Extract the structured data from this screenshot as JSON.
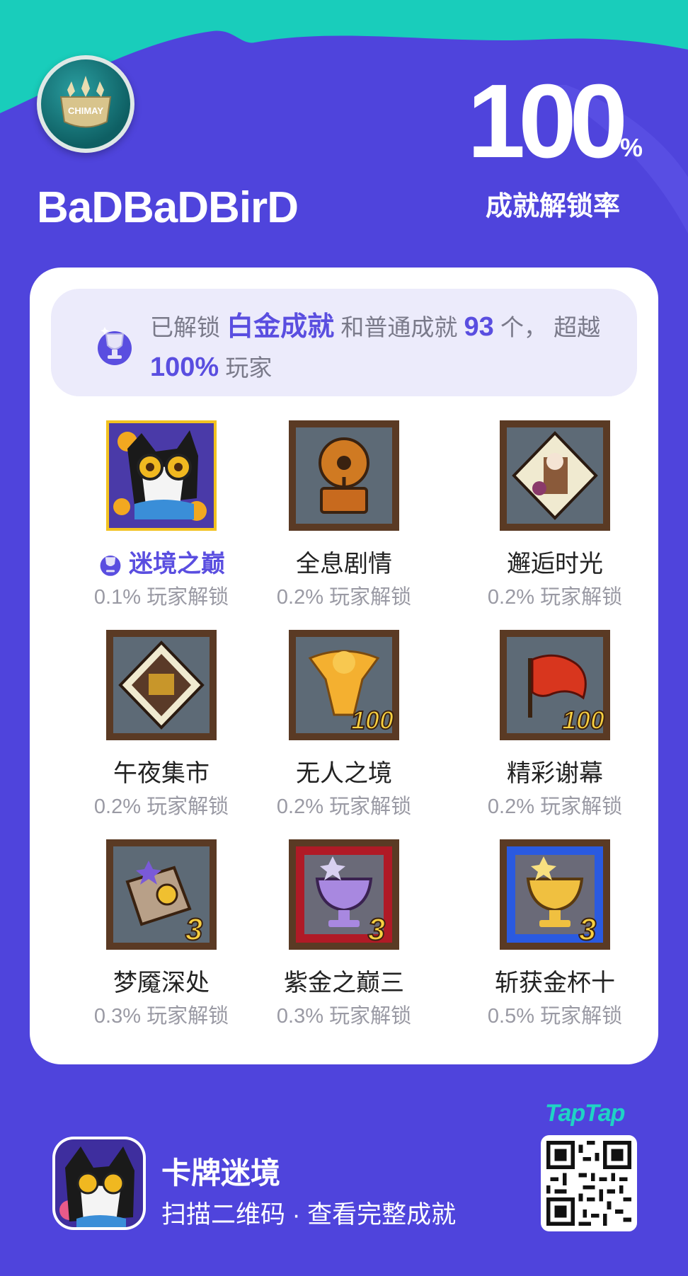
{
  "profile": {
    "username": "BaDBaDBirD",
    "avatar_text": "CHIMAY",
    "avatar_icon": "chimay-crest-icon"
  },
  "rate": {
    "value": "100",
    "percent_sign": "%",
    "label": "成就解锁率"
  },
  "summary": {
    "part1": "已解锁 ",
    "platinum": "白金成就",
    "part2": " 和普通成就 ",
    "count": "93",
    "part3": " 个， 超越 ",
    "percent": "100%",
    "part4": " 玩家"
  },
  "achievements": [
    {
      "name": "迷境之巅",
      "rate": "0.1% 玩家解锁",
      "platinum": true,
      "icon": "cat-portrait-icon"
    },
    {
      "name": "全息剧情",
      "rate": "0.2% 玩家解锁",
      "platinum": false,
      "icon": "gramophone-icon"
    },
    {
      "name": "邂逅时光",
      "rate": "0.2% 玩家解锁",
      "platinum": false,
      "icon": "puzzle-piece-icon"
    },
    {
      "name": "午夜集市",
      "rate": "0.2% 玩家解锁",
      "platinum": false,
      "icon": "puzzle-market-icon"
    },
    {
      "name": "无人之境",
      "rate": "0.2% 玩家解锁",
      "platinum": false,
      "icon": "golden-bird-icon",
      "badge_number": "100"
    },
    {
      "name": "精彩谢幕",
      "rate": "0.2% 玩家解锁",
      "platinum": false,
      "icon": "red-flag-icon",
      "badge_number": "100"
    },
    {
      "name": "梦魇深处",
      "rate": "0.3% 玩家解锁",
      "platinum": false,
      "icon": "scroll-icon",
      "badge_number": "3"
    },
    {
      "name": "紫金之巅三",
      "rate": "0.3% 玩家解锁",
      "platinum": false,
      "icon": "purple-cup-icon",
      "badge_number": "3"
    },
    {
      "name": "斩获金杯十",
      "rate": "0.5% 玩家解锁",
      "platinum": false,
      "icon": "gold-cup-icon",
      "badge_number": "3"
    }
  ],
  "footer": {
    "game_title": "卡牌迷境",
    "subtitle": "扫描二维码 · 查看完整成就",
    "brand": "TapTap"
  },
  "colors": {
    "background": "#4f44dc",
    "accent": "#5a4ee0",
    "teal": "#1fd3c5"
  }
}
